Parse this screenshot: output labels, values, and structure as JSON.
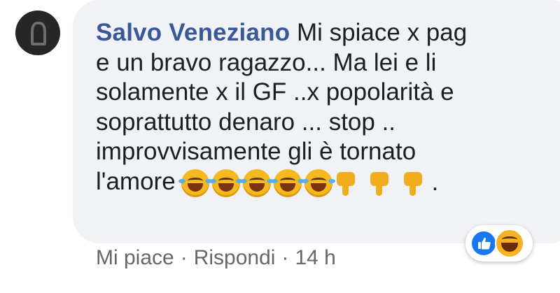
{
  "comment": {
    "author": "Salvo Veneziano",
    "lines": [
      "Mi spiace x pag",
      "e un bravo ragazzo... Ma lei e li",
      "solamente x il GF ..x popolarità e",
      "soprattutto denaro ... stop ..",
      "improvvisamente gli è tornato",
      "l'amore"
    ],
    "trailing": "."
  },
  "emojis": {
    "laugh_count": 5,
    "thumbs_down_count": 3,
    "icon_names": [
      "laughing-crying-icon",
      "thumbs-down-icon"
    ]
  },
  "reactions": {
    "icons": [
      "like-icon",
      "haha-icon"
    ],
    "like_color": "#1877f2",
    "haha_color": "#f7b125"
  },
  "actions": {
    "like": "Mi piace",
    "separator": "·",
    "reply": "Rispondi",
    "time": "14 h"
  },
  "colors": {
    "bubble_bg": "#f0f2f5",
    "author": "#385898",
    "text": "#1c1e21",
    "meta": "#65676b"
  }
}
